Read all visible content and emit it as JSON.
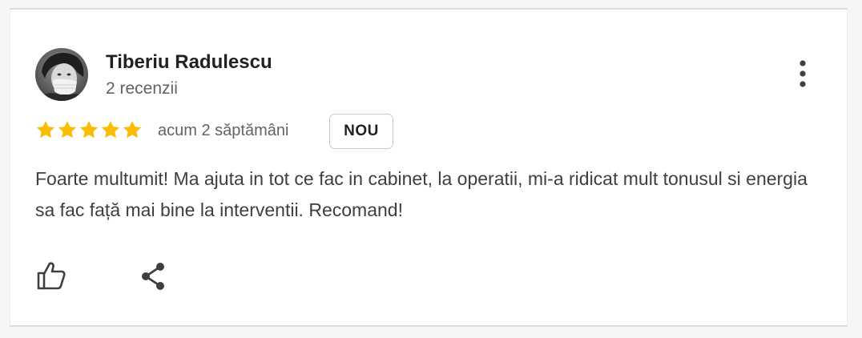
{
  "review": {
    "author_name": "Tiberiu Radulescu",
    "review_count": "2 recenzii",
    "rating": 5,
    "rating_max": 5,
    "time": "acum 2 săptămâni",
    "badge": "NOU",
    "text": "Foarte multumit! Ma ajuta in tot ce fac in cabinet, la operatii, mi-a ridicat mult tonusul si energia sa fac față mai bine la interventii. Recomand!"
  },
  "icons": {
    "avatar": "profile-photo",
    "more": "more-vertical-icon",
    "star": "star-icon",
    "like": "thumbs-up-icon",
    "share": "share-icon"
  },
  "colors": {
    "star": "#fbbc04",
    "name": "#202124",
    "secondary_text": "#5f6368",
    "body_text": "#3c4043",
    "icon": "#3c4043"
  }
}
